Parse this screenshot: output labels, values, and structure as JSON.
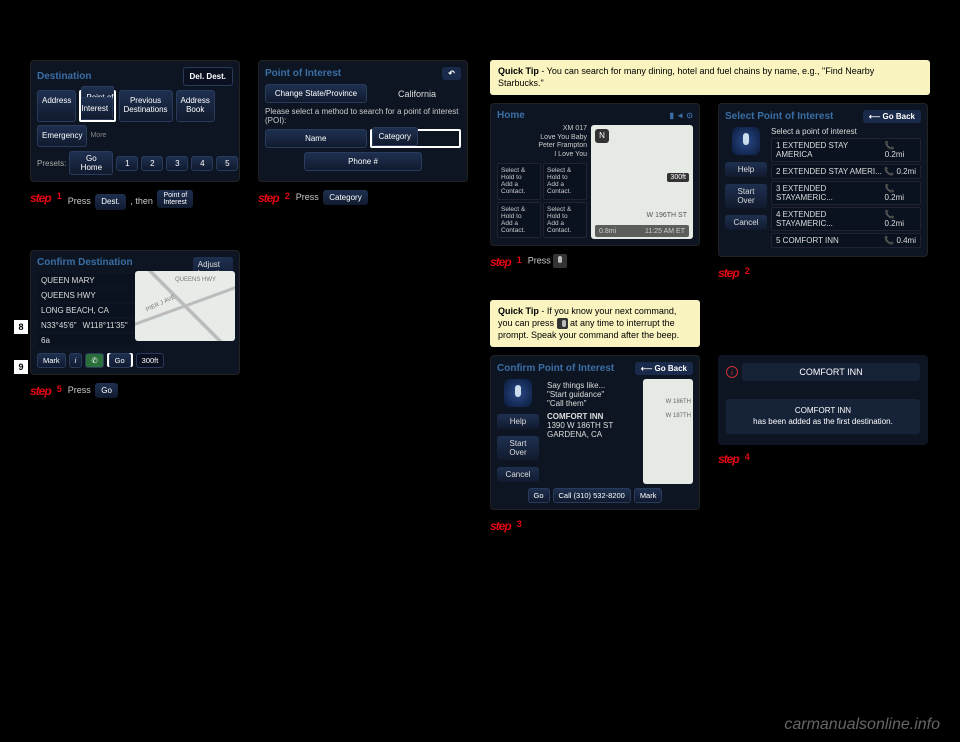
{
  "headers": {
    "left": "",
    "right": ""
  },
  "left": {
    "dest": {
      "title": "Destination",
      "delDest": "Del. Dest.",
      "address": "Address",
      "poi": "Point of\nInterest",
      "prev": "Previous\nDestinations",
      "book": "Address\nBook",
      "emerg": "Emergency",
      "more": "More",
      "goHome": "Go Home",
      "presets": "Presets:",
      "p1": "1",
      "p2": "2",
      "p3": "3",
      "p4": "4",
      "p5": "5"
    },
    "poi": {
      "title": "Point of Interest",
      "changeState": "Change State/Province",
      "state": "California",
      "prompt": "Please select a method to search for a point of interest (POI):",
      "name": "Name",
      "category": "Category",
      "phone": "Phone #"
    },
    "step1": {
      "label": "step",
      "num": "1",
      "text": "Press",
      "destBtn": "Dest.",
      "text2": ", then",
      "poiBtn": "Point of\nInterest"
    },
    "step2": {
      "label": "step",
      "num": "2",
      "text": "Press",
      "catBtn": "Category"
    },
    "confirm": {
      "title": "Confirm Destination",
      "adjust": "Adjust\nLocation",
      "l1": "QUEEN MARY",
      "l2": "QUEENS HWY",
      "l3": "LONG BEACH, CA",
      "lat": "N33°45'6\"",
      "lon": "W118°11'35\"",
      "phone": "6a",
      "mark": "Mark",
      "info": "i",
      "go": "Go",
      "dist": "300ft",
      "road": "QUEENS HWY",
      "road2": "PIER J AVE"
    },
    "step5": {
      "label": "step",
      "num": "5",
      "text": "Press",
      "goBtn": "Go"
    }
  },
  "right": {
    "tip1": {
      "bold": "Quick Tip",
      "text": " - You can search for many dining, hotel and fuel chains by name,  e.g., \"Find Nearby Starbucks.\""
    },
    "home": {
      "title": "Home",
      "radio": "XM 017",
      "song1": "Love You Baby",
      "song2": "Peter Frampton",
      "song3": "I Love You",
      "hold": "Select & Hold to\nAdd a Contact.",
      "compass": "N",
      "street": "W 196TH ST",
      "dist": "300ft",
      "scale": "0.8mi",
      "time": "11:25 AM ET"
    },
    "selectPoi": {
      "title": "Select Point of Interest",
      "goBack": "⟵ Go Back",
      "prompt": "Select a point of interest",
      "help": "Help",
      "startOver": "Start\nOver",
      "cancel": "Cancel",
      "r1n": "1 EXTENDED STAY AMERICA",
      "r1d": "0.2mi",
      "r2n": "2 EXTENDED STAY AMERI...",
      "r2d": "0.2mi",
      "r3n": "3 EXTENDED STAYAMERIC...",
      "r3d": "0.2mi",
      "r4n": "4 EXTENDED STAYAMERIC...",
      "r4d": "0.2mi",
      "r5n": "5 COMFORT INN",
      "r5d": "0.4mi"
    },
    "step1": {
      "label": "step",
      "num": "1",
      "text": "Press"
    },
    "step2": {
      "label": "step",
      "num": "2"
    },
    "tip2": {
      "bold": "Quick Tip",
      "text": " - If you know your next command, you can press ",
      "text2": " at any time to interrupt the prompt. Speak your command after the beep."
    },
    "confirmPoi": {
      "title": "Confirm Point of Interest",
      "goBack": "⟵ Go Back",
      "say": "Say things like...",
      "say1": "\"Start guidance\"",
      "say2": "\"Call them\"",
      "name": "COMFORT INN",
      "addr1": "1390 W 186TH ST",
      "addr2": "GARDENA, CA",
      "help": "Help",
      "startOver": "Start\nOver",
      "cancel": "Cancel",
      "go": "Go",
      "call": "Call (310) 532-8200",
      "mark": "Mark",
      "street": "W 186TH",
      "street2": "W 187TH"
    },
    "notice": {
      "bar": "COMFORT INN",
      "line1": "COMFORT INN",
      "line2": "has been added as the first destination."
    },
    "step3": {
      "label": "step",
      "num": "3"
    },
    "step4": {
      "label": "step",
      "num": "4"
    }
  },
  "pageNums": {
    "a": "8",
    "b": "9"
  },
  "watermark": "carmanualsonline.info"
}
